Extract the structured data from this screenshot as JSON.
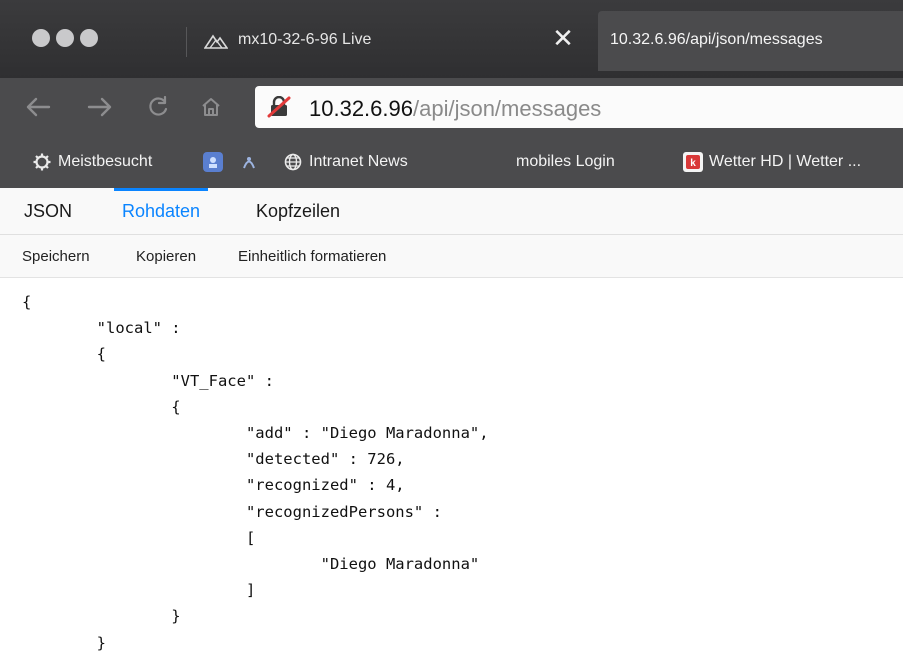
{
  "window": {
    "tabs": [
      {
        "title": "mx10-32-6-96 Live",
        "active": false
      },
      {
        "title": "10.32.6.96/api/json/messages",
        "active": true
      }
    ]
  },
  "navbar": {
    "url_host": "10.32.6.96",
    "url_path": "/api/json/messages"
  },
  "bookmarks": [
    {
      "label": "Meistbesucht",
      "icon": "gear-icon"
    },
    {
      "label": "",
      "icon": "bookmark-favicon"
    },
    {
      "label": "",
      "icon": "bookmark-favicon"
    },
    {
      "label": "Intranet News",
      "icon": "globe-icon"
    },
    {
      "label": "mobiles Login",
      "icon": "bookmark-favicon"
    },
    {
      "label": "Wetter HD | Wetter ...",
      "icon": "weather-favicon"
    }
  ],
  "viewer": {
    "tabs": [
      "JSON",
      "Rohdaten",
      "Kopfzeilen"
    ],
    "active_tab": "Rohdaten",
    "actions": [
      "Speichern",
      "Kopieren",
      "Einheitlich formatieren"
    ]
  },
  "raw_lines": [
    "{",
    "        \"local\" :",
    "        {",
    "                \"VT_Face\" :",
    "                {",
    "                        \"add\" : \"Diego Maradonna\",",
    "                        \"detected\" : 726,",
    "                        \"recognized\" : 4,",
    "                        \"recognizedPersons\" :",
    "                        [",
    "                                \"Diego Maradonna\"",
    "                        ]",
    "                }",
    "        }",
    "}"
  ],
  "colors": {
    "accent": "#0a84ff",
    "chrome_dark": "#2f2f31",
    "chrome": "#4b4b4d"
  }
}
